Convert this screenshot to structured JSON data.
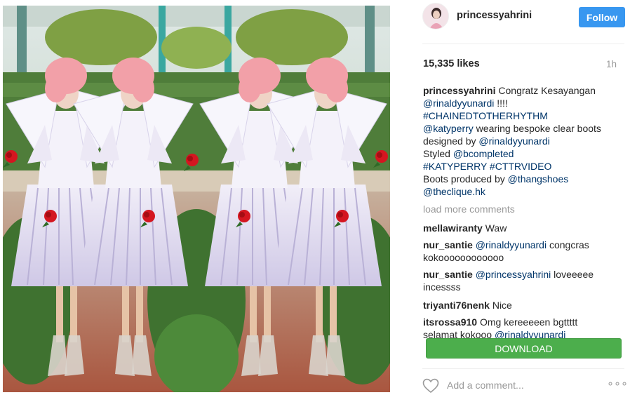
{
  "post": {
    "username": "princessyahrini",
    "follow_label": "Follow",
    "likes": "15,335 likes",
    "time": "1h"
  },
  "caption": {
    "username": "princessyahrini",
    "text1": " Congratz Kesayangan",
    "mention1": "@rinaldyyunardi",
    "exclaim": " !!!!",
    "hashtag1": "#CHAINEDTOTHERHYTHM",
    "mention2": "@katyperry",
    "text2": " wearing bespoke clear boots",
    "text3": "designed by ",
    "mention3": "@rinaldyyunardi",
    "text4": "Styled ",
    "mention4": "@bcompleted",
    "hashtag2": "#KATYPERRY",
    "hashtag3": " #CTTRVIDEO",
    "text5": "Boots produced by ",
    "mention5": "@thangshoes",
    "mention6": "@theclique.hk"
  },
  "load_more": "load more comments",
  "comments": [
    {
      "user": "mellawiranty",
      "text": " Waw"
    },
    {
      "user": "nur_santie",
      "mention": " @rinaldyyunardi",
      "text": " congcras",
      "line2": "kokoooooooooooo"
    },
    {
      "user": "nur_santie",
      "mention": " @princessyahrini",
      "text": " loveeeee",
      "line2": "incessss"
    },
    {
      "user": "triyanti76nenk",
      "text": " Nice"
    },
    {
      "user": "itsrossa910",
      "text": " Omg kereeeeen bgttttt",
      "line2_text": "selamat kokooo ",
      "line2_mention": "@rinaldyyunardi"
    }
  ],
  "download_label": "DOWNLOAD",
  "add_comment_placeholder": "Add a comment...",
  "more_label": "∘∘∘",
  "icons": {
    "heart": "heart-icon",
    "more": "more-options-icon",
    "avatar": "avatar"
  },
  "colors": {
    "follow_bg": "#3897f0",
    "link": "#003569",
    "download_bg": "#4cae4c",
    "muted": "#999999"
  }
}
